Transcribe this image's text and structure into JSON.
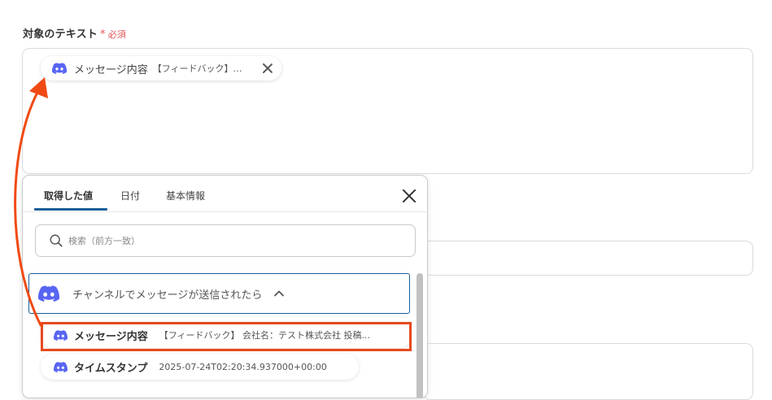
{
  "field": {
    "label": "対象のテキスト",
    "required_mark": "*",
    "required_text": "必須"
  },
  "chip": {
    "icon": "discord-icon",
    "title": "メッセージ内容",
    "detail": "【フィードバック】会社名：テスト株式会社 投稿..."
  },
  "popover": {
    "tabs": [
      {
        "label": "取得した値",
        "active": true
      },
      {
        "label": "日付",
        "active": false
      },
      {
        "label": "基本情報",
        "active": false
      }
    ],
    "search": {
      "placeholder": "検索（前方一致）"
    },
    "section": {
      "label": "チャンネルでメッセージが送信されたら",
      "icon": "discord-icon",
      "expanded": true
    },
    "items": [
      {
        "name": "メッセージ内容",
        "value": "【フィードバック】 会社名：テスト株式会社 投稿...",
        "highlighted": true
      },
      {
        "name": "タイムスタンプ",
        "value": "2025-07-24T02:20:34.937000+00:00",
        "highlighted": false
      }
    ]
  },
  "colors": {
    "accent": "#1a5f9a",
    "required": "#e2555a",
    "highlight": "#e54a1c",
    "discord": "#5865f2"
  }
}
